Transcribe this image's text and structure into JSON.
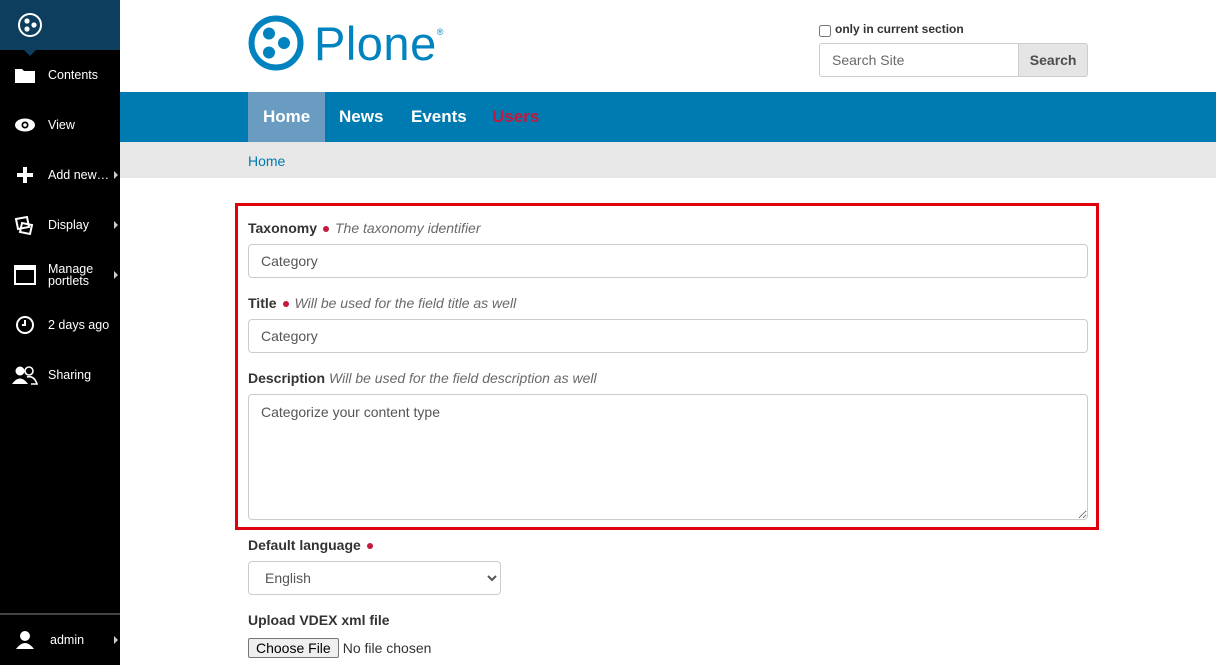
{
  "toolbar": {
    "items": [
      {
        "label": "Contents",
        "icon": "folder-icon",
        "submenu": false
      },
      {
        "label": "View",
        "icon": "eye-icon",
        "submenu": false
      },
      {
        "label": "Add new…",
        "icon": "plus-icon",
        "submenu": true
      },
      {
        "label": "Display",
        "icon": "display-icon",
        "submenu": true
      },
      {
        "label": "Manage portlets",
        "icon": "window-icon",
        "submenu": true
      },
      {
        "label": "2 days ago",
        "icon": "clock-icon",
        "submenu": false
      },
      {
        "label": "Sharing",
        "icon": "users-icon",
        "submenu": false
      }
    ],
    "user_label": "admin"
  },
  "header": {
    "logo_text": "Plone",
    "logo_reg": "®",
    "only_current_section_label": "only in current section",
    "search_placeholder": "Search Site",
    "search_button": "Search"
  },
  "nav": {
    "tabs": [
      {
        "label": "Home",
        "active": true
      },
      {
        "label": "News",
        "active": false
      },
      {
        "label": "Events",
        "active": false
      },
      {
        "label": "Users",
        "active": false
      }
    ]
  },
  "breadcrumb": {
    "home": "Home"
  },
  "form": {
    "taxonomy": {
      "label": "Taxonomy",
      "help": "The taxonomy identifier",
      "value": "Category"
    },
    "title": {
      "label": "Title",
      "help": "Will be used for the field title as well",
      "value": "Category"
    },
    "description": {
      "label": "Description",
      "help": "Will be used for the field description as well",
      "value": "Categorize your content type"
    },
    "default_language": {
      "label": "Default language",
      "selected": "English"
    },
    "upload": {
      "label": "Upload VDEX xml file",
      "button": "Choose File",
      "status": "No file chosen"
    }
  },
  "colors": {
    "brand": "#0083be",
    "nav_bg": "#007bb1",
    "users_tab": "#c4183c",
    "required": "#c4183c",
    "highlight": "#e0000b"
  }
}
